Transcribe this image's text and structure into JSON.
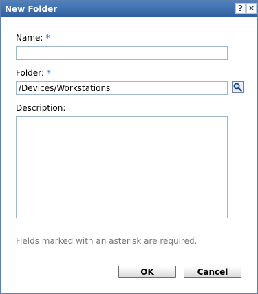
{
  "dialog": {
    "title": "New Folder",
    "help_label": "?",
    "close_label": "✕"
  },
  "form": {
    "name_label": "Name:",
    "folder_label": "Folder:",
    "description_label": "Description:",
    "required_marker": "*",
    "name_value": "",
    "folder_value": "/Devices/Workstations",
    "description_value": "",
    "note": "Fields marked with an asterisk are required."
  },
  "buttons": {
    "ok": "OK",
    "cancel": "Cancel"
  },
  "icons": {
    "browse": "magnifier-icon",
    "help": "help-icon",
    "close": "close-icon"
  },
  "colors": {
    "titlebar": "#2f5f9e",
    "required_marker": "#2f6bd1"
  }
}
